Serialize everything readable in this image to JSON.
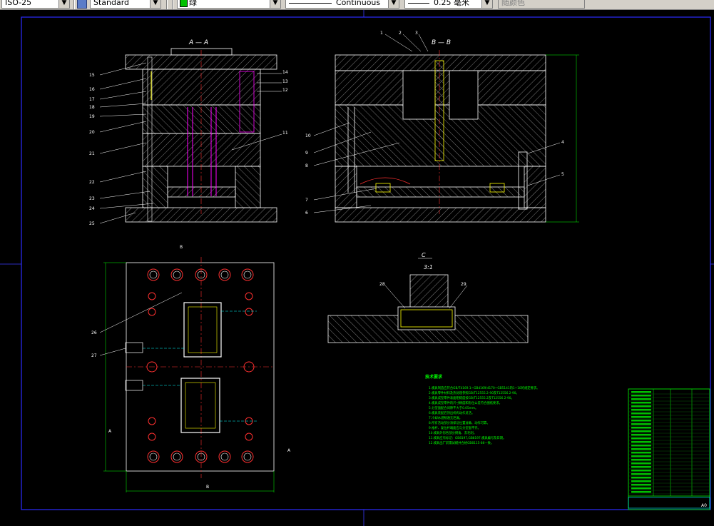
{
  "toolbar": {
    "scale_value": "ISO-25",
    "text_style": "Standard",
    "color_name": "绿",
    "color_hex": "#00c000",
    "linetype": "Continuous",
    "lineweight": "0.25 毫米",
    "plot_style": "随颜色"
  },
  "drawing": {
    "section_aa": "A — A",
    "section_bb": "B — B",
    "detail_label": "C",
    "detail_scale": "3:1",
    "left_callouts": [
      "15",
      "16",
      "17",
      "18",
      "19",
      "20",
      "21",
      "22",
      "23",
      "24",
      "25"
    ],
    "left_right_callouts": [
      "14",
      "13",
      "12",
      "11"
    ],
    "right_left_callouts": [
      "1",
      "2",
      "3",
      "10",
      "9",
      "8",
      "7",
      "6"
    ],
    "right_right_callouts": [
      "4",
      "5"
    ],
    "plan_callouts": [
      "26",
      "27"
    ],
    "detail_callouts": [
      "28",
      "29"
    ],
    "view_marks": [
      "A",
      "A",
      "B",
      "B"
    ],
    "tech_title": "技术要求",
    "tech_notes": [
      "1.模具制造应符合GB/T4169.1~GB4169/4170~GB5141的1~10的规定要求。",
      "2.模具零件材料及热处理参照GB/T12555.2-90及T12556.2-90。",
      "3.模具成型零件表面粗糙度按GB/T12555.2及T12556.2-90。",
      "4.模具成型零件的尺寸精度和形位公差符合图纸要求。",
      "5.分型面配合间隙不大于0.05mm。",
      "6.模具装配后顶出机构动作灵活。",
      "7.冷却水道畅通无泄漏。",
      "8.所有活动部分须保证位置准确、动作可靠。",
      "9.推杆、复位杆端面应与分型面平齐。",
      "10.模具外形各部分倒角、去毛刺。",
      "11.模具应有标记：GB8197,GB8197,模具编号及日期。",
      "12.模具出厂前需试模并合格GB8115-86一致。"
    ],
    "title_block_size": "A0"
  }
}
